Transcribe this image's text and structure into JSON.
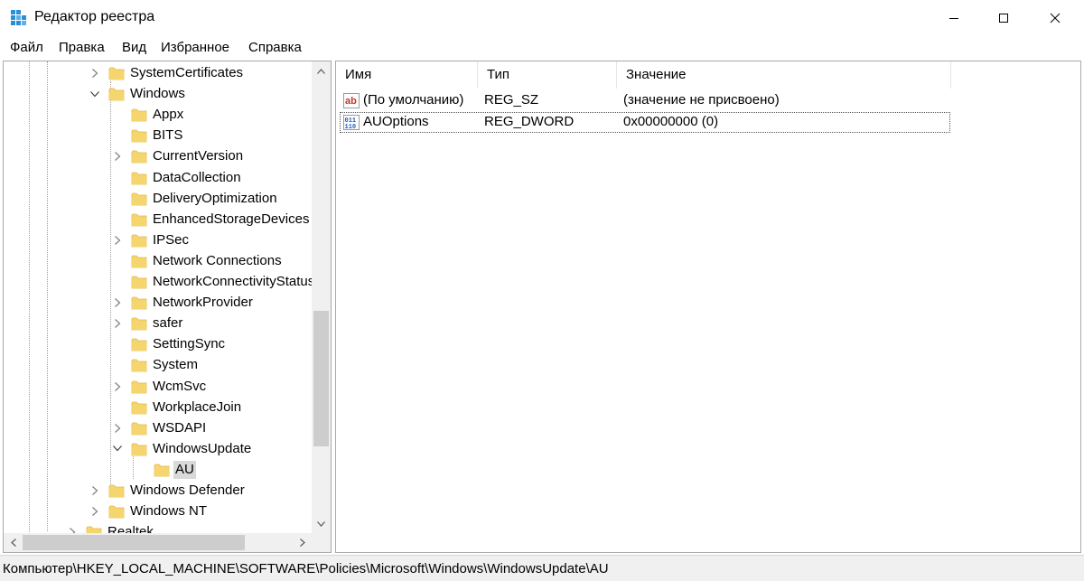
{
  "window": {
    "title": "Редактор реестра"
  },
  "menu": {
    "items": [
      "Файл",
      "Правка",
      "Вид",
      "Избранное",
      "Справка"
    ]
  },
  "tree": {
    "items": [
      {
        "label": "SystemCertificates",
        "expander": "collapsed"
      },
      {
        "label": "Windows",
        "expander": "expanded"
      },
      {
        "label": "Appx",
        "expander": "none"
      },
      {
        "label": "BITS",
        "expander": "none"
      },
      {
        "label": "CurrentVersion",
        "expander": "collapsed"
      },
      {
        "label": "DataCollection",
        "expander": "none"
      },
      {
        "label": "DeliveryOptimization",
        "expander": "none"
      },
      {
        "label": "EnhancedStorageDevices",
        "expander": "none"
      },
      {
        "label": "IPSec",
        "expander": "collapsed"
      },
      {
        "label": "Network Connections",
        "expander": "none"
      },
      {
        "label": "NetworkConnectivityStatusIndicator",
        "expander": "none"
      },
      {
        "label": "NetworkProvider",
        "expander": "collapsed"
      },
      {
        "label": "safer",
        "expander": "collapsed"
      },
      {
        "label": "SettingSync",
        "expander": "none"
      },
      {
        "label": "System",
        "expander": "none"
      },
      {
        "label": "WcmSvc",
        "expander": "collapsed"
      },
      {
        "label": "WorkplaceJoin",
        "expander": "none"
      },
      {
        "label": "WSDAPI",
        "expander": "collapsed"
      },
      {
        "label": "WindowsUpdate",
        "expander": "expanded"
      },
      {
        "label": "AU",
        "expander": "none",
        "selected": true
      },
      {
        "label": "Windows Defender",
        "expander": "collapsed"
      },
      {
        "label": "Windows NT",
        "expander": "collapsed"
      },
      {
        "label": "Realtek",
        "expander": "collapsed"
      }
    ]
  },
  "list": {
    "columns": [
      "Имя",
      "Тип",
      "Значение"
    ],
    "rows": [
      {
        "icon": "string-value-icon",
        "name": "(По умолчанию)",
        "type": "REG_SZ",
        "value": "(значение не присвоено)"
      },
      {
        "icon": "binary-value-icon",
        "name": "AUOptions",
        "type": "REG_DWORD",
        "value": "0x00000000 (0)"
      }
    ]
  },
  "status": {
    "path": "Компьютер\\HKEY_LOCAL_MACHINE\\SOFTWARE\\Policies\\Microsoft\\Windows\\WindowsUpdate\\AU"
  },
  "colors": {
    "folder": "#f5d66e",
    "folder_dark": "#e3b84a",
    "selection": "#d9d9d9",
    "app_icon": "#2c8fd6"
  }
}
